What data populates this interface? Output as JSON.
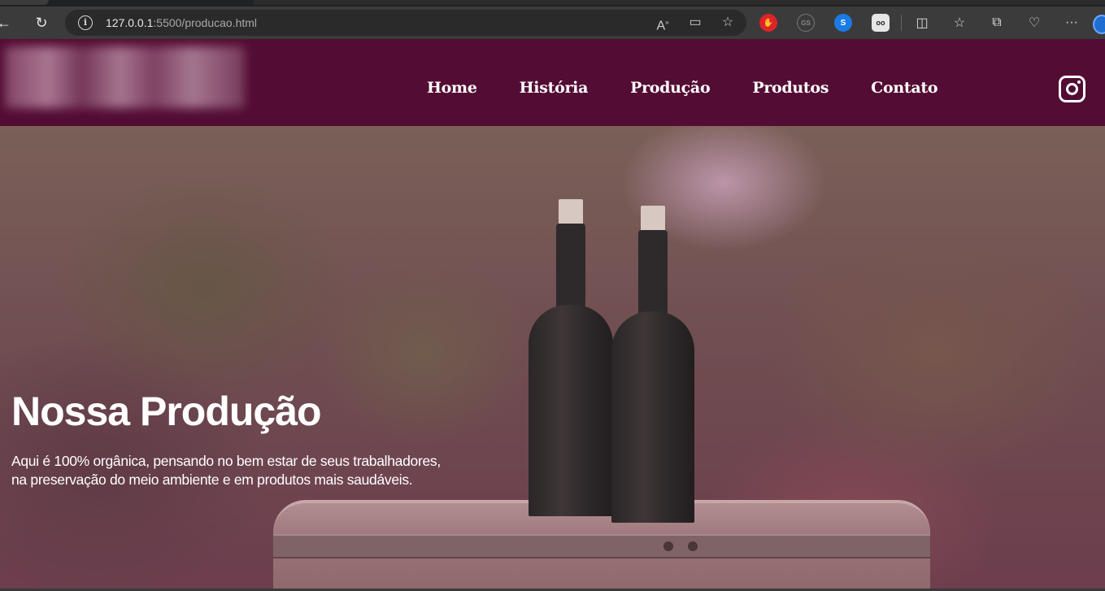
{
  "browser": {
    "url_host": "127.0.0.1",
    "url_rest": ":5500/producao.html",
    "extensions": [
      "adblock-icon",
      "extension-gs-icon",
      "shazam-icon",
      "extension-dark-icon"
    ]
  },
  "site": {
    "nav": [
      "Home",
      "História",
      "Produção",
      "Produtos",
      "Contato"
    ]
  },
  "hero": {
    "title": "Nossa Produção",
    "line1": "Aqui é 100% orgânica, pensando no bem estar de seus trabalhadores,",
    "line2": "na preservação do meio ambiente e em produtos mais saudáveis."
  },
  "colors": {
    "header_bg": "#530c33",
    "nav_text": "#ffffff"
  }
}
